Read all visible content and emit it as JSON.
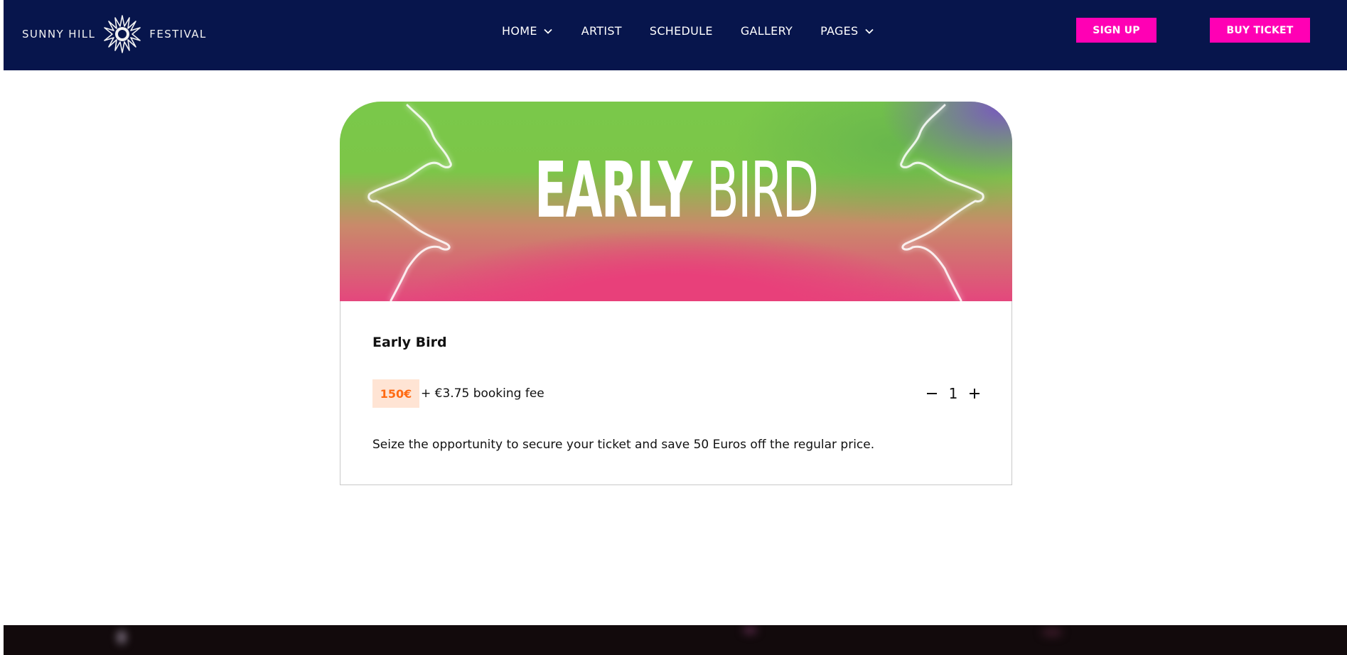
{
  "header": {
    "logo": {
      "left_text": "SUNNY HILL",
      "right_text": "FESTIVAL",
      "icon": "sun-starburst-icon"
    },
    "nav": [
      {
        "label": "HOME",
        "has_dropdown": true
      },
      {
        "label": "ARTIST",
        "has_dropdown": false
      },
      {
        "label": "SCHEDULE",
        "has_dropdown": false
      },
      {
        "label": "GALLERY",
        "has_dropdown": false
      },
      {
        "label": "PAGES",
        "has_dropdown": true
      }
    ],
    "signup_label": "SIGN UP",
    "buy_label": "BUY TICKET"
  },
  "ticket": {
    "banner_word1": "EARLY",
    "banner_word2": "BIRD",
    "name": "Early Bird",
    "price": "150€",
    "fee": "+ €3.75 booking fee",
    "quantity": "1",
    "description": "Seize the opportunity to secure your ticket and save 50 Euros off the regular price."
  },
  "colors": {
    "header_bg": "#07154c",
    "accent_pink": "#ff00b4",
    "price_text": "#ff6a12",
    "price_bg": "#ffe4d4"
  }
}
